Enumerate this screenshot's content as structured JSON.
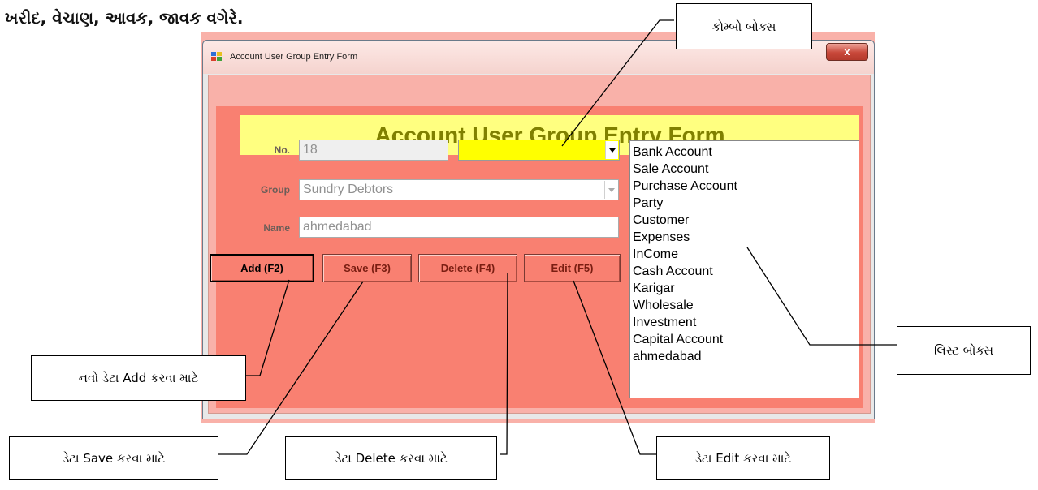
{
  "heading": "ખરીદ, વેચાણ, આવક, જાવક વગેરે.",
  "window": {
    "title": "Account User Group Entry Form",
    "close_glyph": "x"
  },
  "form": {
    "title": "Account User Group Entry Form",
    "no_label": "No.",
    "no_value": "18",
    "group_label": "Group",
    "group_value": "Sundry Debtors",
    "name_label": "Name",
    "name_value": "ahmedabad",
    "combo_value": ""
  },
  "buttons": {
    "add": "Add (F2)",
    "save": "Save (F3)",
    "delete": "Delete (F4)",
    "edit": "Edit (F5)"
  },
  "list_items": [
    "Bank Account",
    "Sale Account",
    "Purchase Account",
    "Party",
    "Customer",
    "Expenses",
    "InCome",
    "Cash Account",
    "Karigar",
    "Wholesale",
    "Investment",
    "Capital Account",
    "ahmedabad"
  ],
  "callouts": {
    "combo": "કોમ્બો બોક્સ",
    "list": "લિસ્ટ બોક્સ",
    "add": "નવો ડેટા Add કરવા માટે",
    "save": "ડેટા Save કરવા માટે",
    "delete": "ડેટા Delete કરવા માટે",
    "edit": "ડેટા Edit કરવા માટે"
  },
  "colors": {
    "form_background": "#F98071",
    "title_band": "#FFFF80",
    "title_text": "#808000",
    "combo_highlight": "#FFFF00"
  }
}
